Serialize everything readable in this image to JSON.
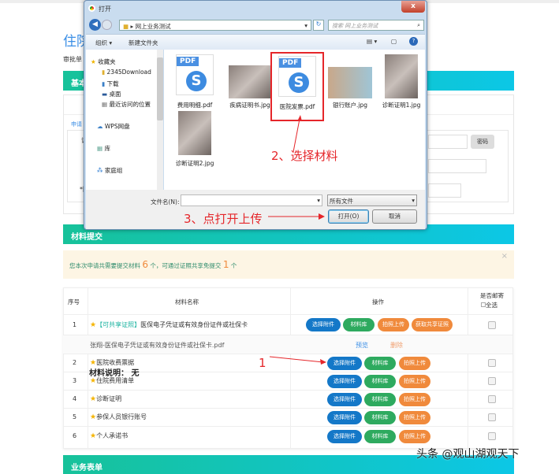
{
  "page": {
    "title": "住院",
    "approval_label": "审批单",
    "section_basic": "基本",
    "apply_label": "申请",
    "field_label_1": "证",
    "field_label_2": "*团",
    "cert_button": "密码",
    "section_materials": "材料提交",
    "section_form": "业务表单"
  },
  "notice": {
    "text_a": "您本次申请共需要提交材料",
    "count_total": "6",
    "text_b": "个，可通过证照共享免提交",
    "count_shared": "1",
    "text_c": "个"
  },
  "table": {
    "headers": [
      "序号",
      "材料名称",
      "操作",
      "是否邮寄"
    ],
    "select_all": "全选",
    "rows": [
      {
        "no": "1",
        "tag": "【可共享证照】",
        "name": "医保电子凭证或有效身份证件或社保卡"
      },
      {
        "no": "2",
        "name": "医院收费票据"
      },
      {
        "no": "3",
        "name": "住院费用清单"
      },
      {
        "no": "4",
        "name": "诊断证明"
      },
      {
        "no": "5",
        "name": "参保人员银行账号"
      },
      {
        "no": "6",
        "name": "个人承诺书"
      }
    ],
    "attachment": {
      "file": "张翔-医保电子凭证或有效身份证件或社保卡.pdf",
      "preview": "预览",
      "delete": "删除"
    },
    "buttons": {
      "select": "选择附件",
      "library": "材料库",
      "photo": "拍照上传",
      "shared": "获取共享证照"
    }
  },
  "annotations": {
    "step1": "1",
    "step2": "2、选择材料",
    "step3": "3、点打开上传",
    "note": "材料说明： 无"
  },
  "watermark": "头条 @观山湖观天下",
  "dialog": {
    "title": "打开",
    "path": "网上业务测试",
    "search_placeholder": "搜索 网上业务测试",
    "organize": "组织 ▾",
    "new_folder": "新建文件夹",
    "nav": [
      "收藏夹",
      "2345Download",
      "下载",
      "桌面",
      "最近访问的位置",
      "WPS网盘",
      "库",
      "家庭组"
    ],
    "files": [
      "费用明细.pdf",
      "疾病证明书.jpg",
      "医院发票.pdf",
      "银行账户.jpg",
      "诊断证明1.jpg",
      "诊断证明2.jpg"
    ],
    "filename_label": "文件名(N):",
    "filename_value": "",
    "filetype": "所有文件",
    "open": "打开(O)",
    "cancel": "取消",
    "pdf_tag": "PDF"
  },
  "colors": {
    "accent_green": "#17c29a",
    "accent_cyan": "#0cc7e6",
    "annotation_red": "#e5262a"
  }
}
